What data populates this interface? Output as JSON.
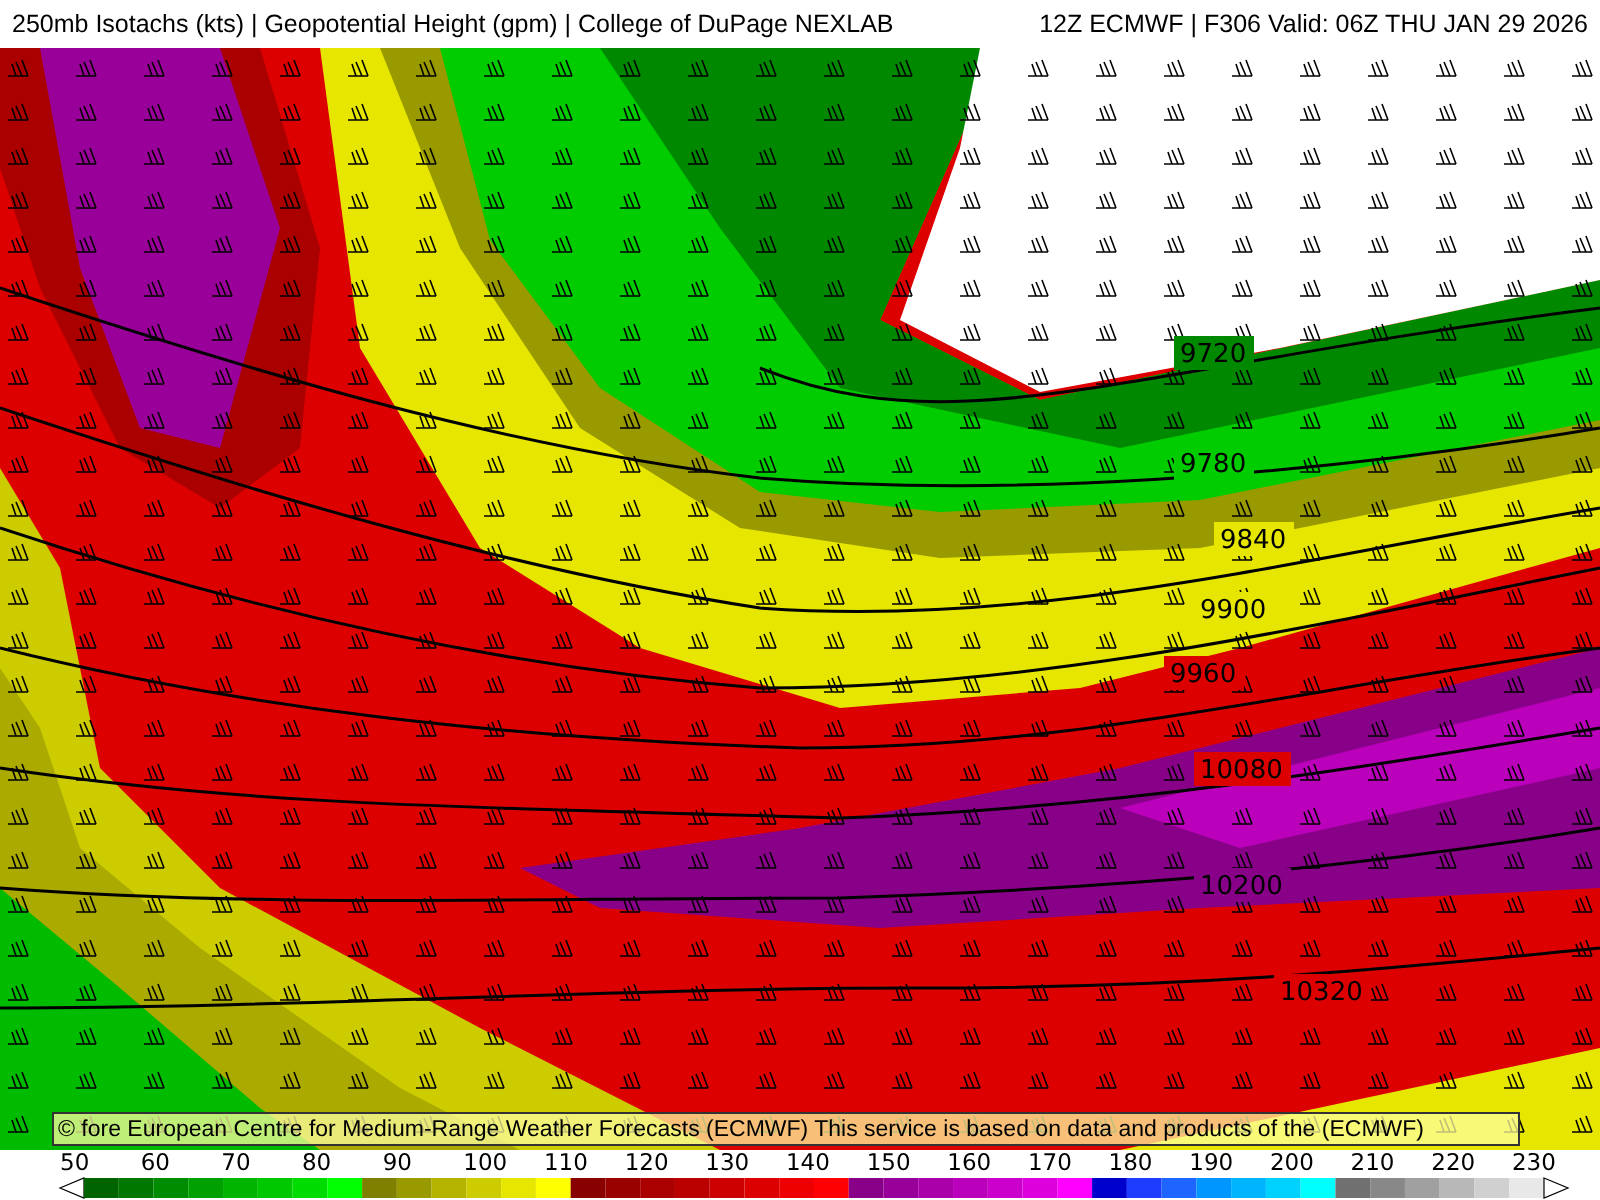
{
  "title_bar": {
    "left": "250mb Isotachs (kts) | Geopotential Height (gpm) | College of DuPage NEXLAB",
    "right": "12Z ECMWF | F306 Valid: 06Z THU JAN 29 2026"
  },
  "map": {
    "contour_labels": [
      {
        "text": "9720",
        "kind": "height"
      },
      {
        "text": "9780",
        "kind": "height"
      },
      {
        "text": "9840",
        "kind": "height"
      },
      {
        "text": "9900",
        "kind": "height"
      },
      {
        "text": "9960",
        "kind": "height"
      },
      {
        "text": "10080",
        "kind": "height"
      },
      {
        "text": "10200",
        "kind": "height"
      },
      {
        "text": "10320",
        "kind": "height"
      }
    ]
  },
  "attribution": "© fore European Centre for Medium-Range Weather Forecasts (ECMWF)  This service is based on data and products of the (ECMWF)",
  "colorbar": {
    "labels": [
      "50",
      "60",
      "70",
      "80",
      "90",
      "100",
      "110",
      "120",
      "130",
      "140",
      "150",
      "160",
      "170",
      "180",
      "190",
      "200",
      "210",
      "220",
      "230"
    ],
    "segments": [
      {
        "color": "#006400"
      },
      {
        "color": "#007800"
      },
      {
        "color": "#008c00"
      },
      {
        "color": "#00a000"
      },
      {
        "color": "#00b400"
      },
      {
        "color": "#00c800"
      },
      {
        "color": "#00dc00"
      },
      {
        "color": "#00ff00"
      },
      {
        "color": "#808000"
      },
      {
        "color": "#999900"
      },
      {
        "color": "#b3b300"
      },
      {
        "color": "#cccc00"
      },
      {
        "color": "#e6e600"
      },
      {
        "color": "#ffff00"
      },
      {
        "color": "#880000"
      },
      {
        "color": "#990000"
      },
      {
        "color": "#aa0000"
      },
      {
        "color": "#bb0000"
      },
      {
        "color": "#cc0000"
      },
      {
        "color": "#dd0000"
      },
      {
        "color": "#ee0000"
      },
      {
        "color": "#ff0000"
      },
      {
        "color": "#880088"
      },
      {
        "color": "#990099"
      },
      {
        "color": "#aa00aa"
      },
      {
        "color": "#bb00bb"
      },
      {
        "color": "#cc00cc"
      },
      {
        "color": "#dd00dd"
      },
      {
        "color": "#ff00ff"
      },
      {
        "color": "#0000cc"
      },
      {
        "color": "#1e3cff"
      },
      {
        "color": "#1e64ff"
      },
      {
        "color": "#0096ff"
      },
      {
        "color": "#00b4ff"
      },
      {
        "color": "#00d2ff"
      },
      {
        "color": "#00ffff"
      },
      {
        "color": "#707070"
      },
      {
        "color": "#888888"
      },
      {
        "color": "#a0a0a0"
      },
      {
        "color": "#b8b8b8"
      },
      {
        "color": "#d0d0d0"
      },
      {
        "color": "#e8e8e8"
      }
    ]
  }
}
